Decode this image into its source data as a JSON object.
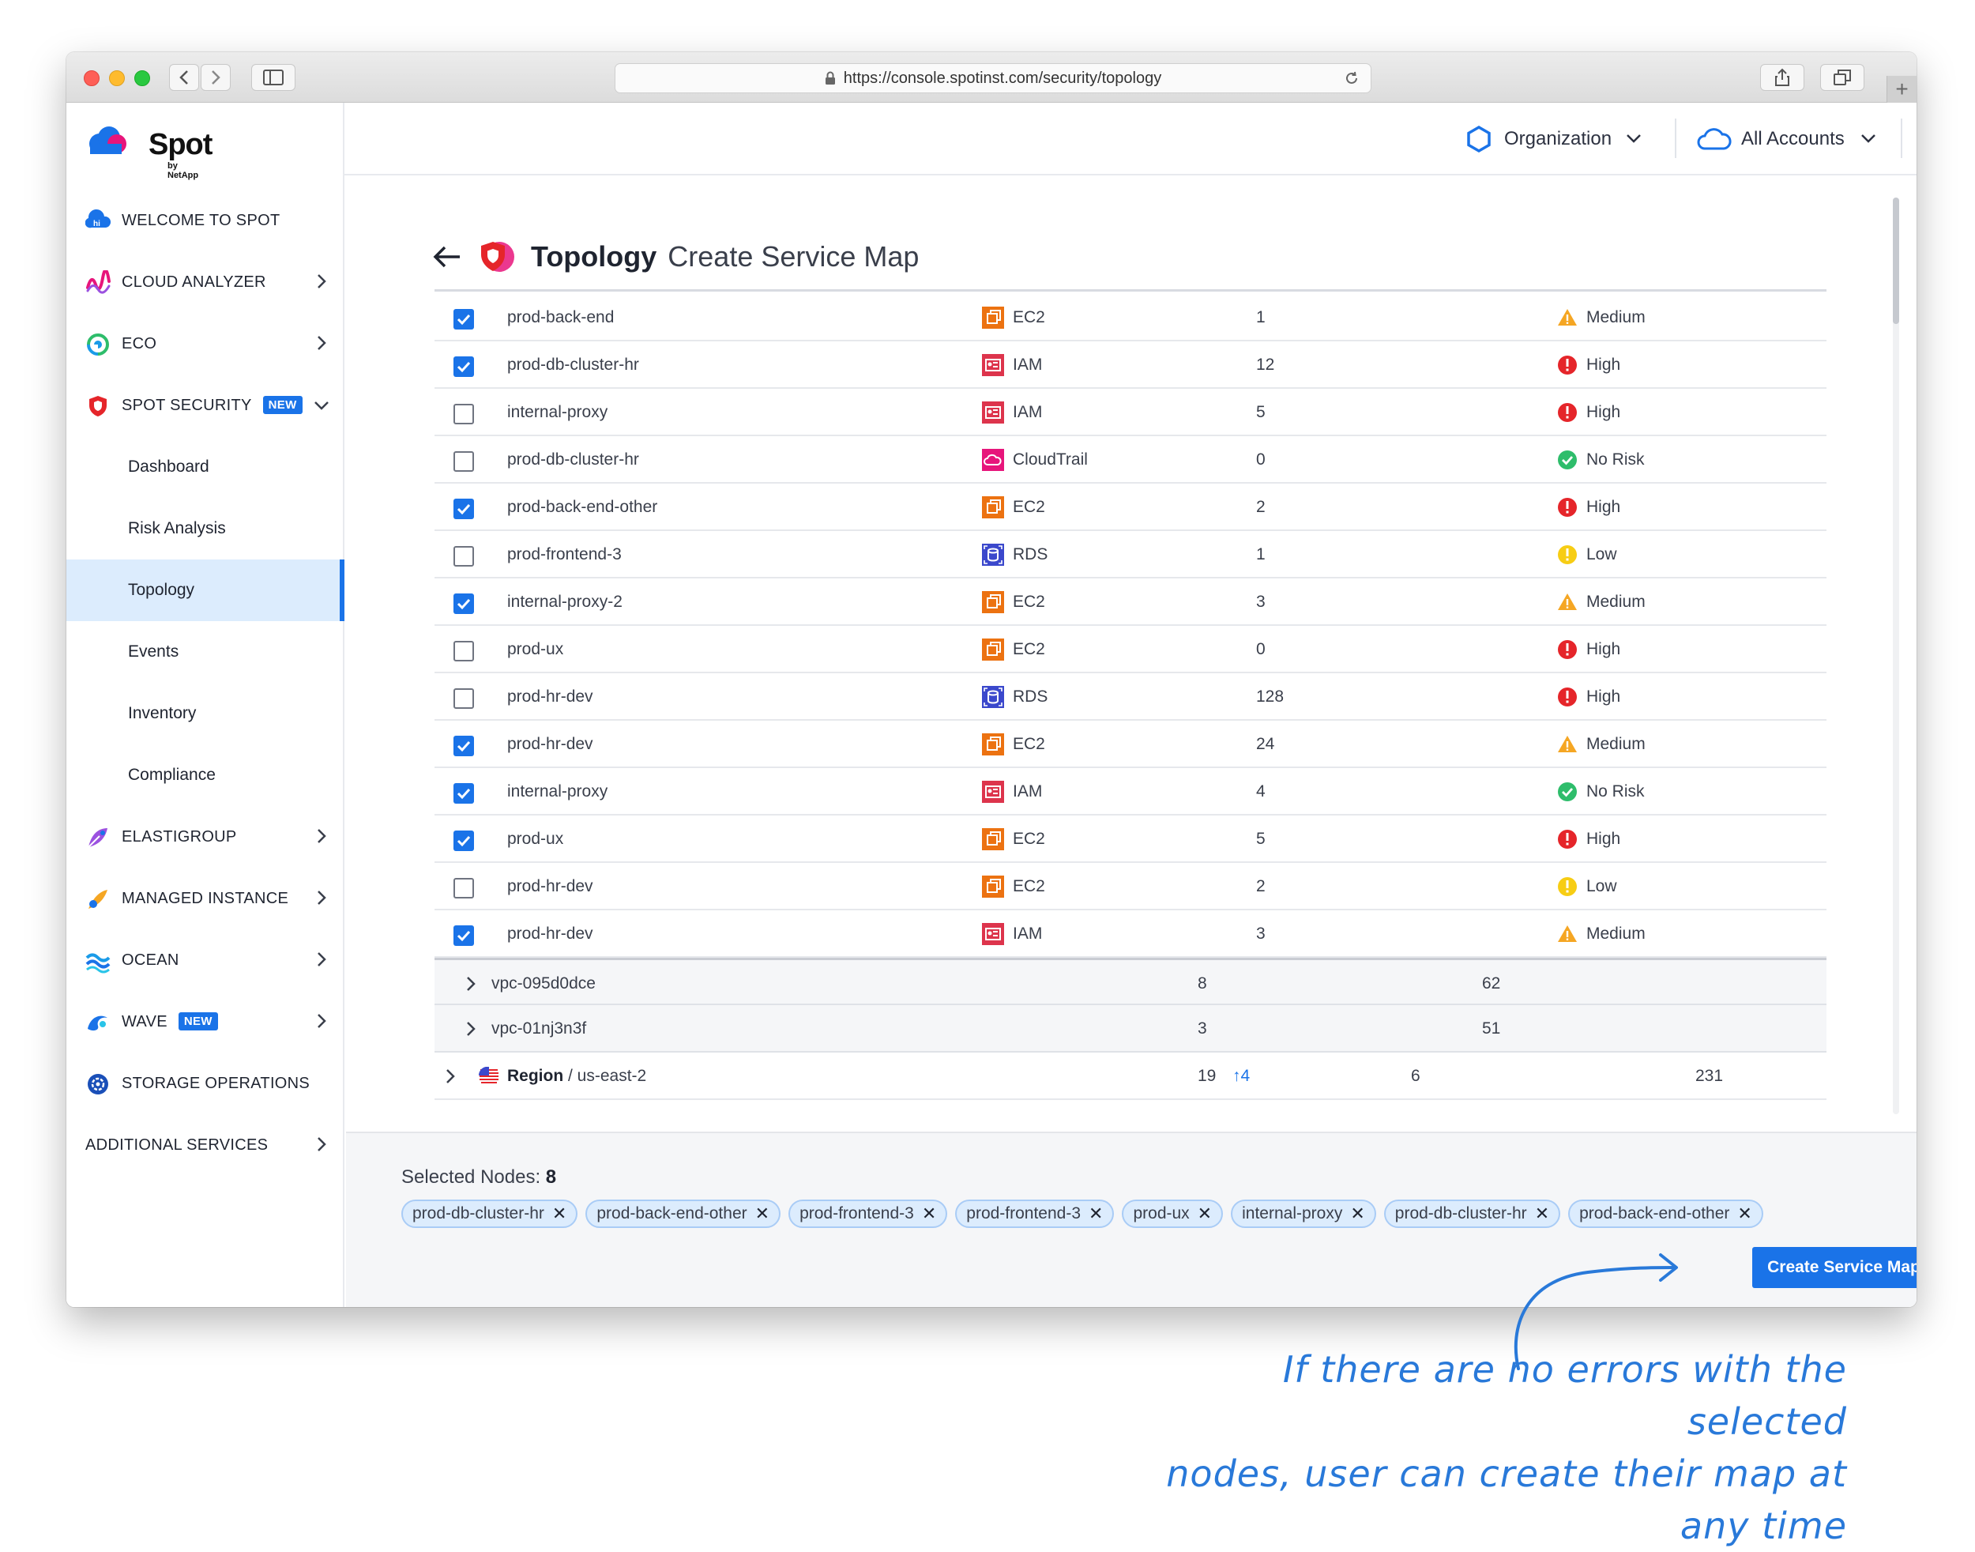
{
  "browser": {
    "url": "https://console.spotinst.com/security/topology"
  },
  "brand": {
    "name": "Spot",
    "sub": "by NetApp",
    "accent": "#1a73e8"
  },
  "sidebar": {
    "items": [
      {
        "label": "WELCOME TO SPOT",
        "icon": "hi-icon"
      },
      {
        "label": "CLOUD ANALYZER",
        "icon": "cloud-analyzer-icon"
      },
      {
        "label": "ECO",
        "icon": "eco-icon"
      },
      {
        "label": "SPOT SECURITY",
        "icon": "shield-icon",
        "badge": "NEW"
      },
      {
        "label": "ELASTIGROUP",
        "icon": "elastigroup-icon"
      },
      {
        "label": "MANAGED INSTANCE",
        "icon": "managed-instance-icon"
      },
      {
        "label": "OCEAN",
        "icon": "ocean-icon"
      },
      {
        "label": "WAVE",
        "icon": "wave-icon",
        "badge": "NEW"
      },
      {
        "label": "STORAGE OPERATIONS",
        "icon": "gear-icon"
      },
      {
        "label": "ADDITIONAL SERVICES"
      }
    ],
    "security_sub": [
      "Dashboard",
      "Risk Analysis",
      "Topology",
      "Events",
      "Inventory",
      "Compliance"
    ]
  },
  "header": {
    "organization": "Organization",
    "accounts": "All Accounts"
  },
  "page": {
    "title": "Topology",
    "subtitle": "Create Service Map"
  },
  "rows": [
    {
      "checked": true,
      "name": "prod-back-end",
      "type": "EC2",
      "count": "1",
      "risk": "Medium"
    },
    {
      "checked": true,
      "name": "prod-db-cluster-hr",
      "type": "IAM",
      "count": "12",
      "risk": "High"
    },
    {
      "checked": false,
      "name": "internal-proxy",
      "type": "IAM",
      "count": "5",
      "risk": "High"
    },
    {
      "checked": false,
      "name": "prod-db-cluster-hr",
      "type": "CloudTrail",
      "count": "0",
      "risk": "No Risk"
    },
    {
      "checked": true,
      "name": "prod-back-end-other",
      "type": "EC2",
      "count": "2",
      "risk": "High"
    },
    {
      "checked": false,
      "name": "prod-frontend-3",
      "type": "RDS",
      "count": "1",
      "risk": "Low"
    },
    {
      "checked": true,
      "name": "internal-proxy-2",
      "type": "EC2",
      "count": "3",
      "risk": "Medium"
    },
    {
      "checked": false,
      "name": "prod-ux",
      "type": "EC2",
      "count": "0",
      "risk": "High"
    },
    {
      "checked": false,
      "name": "prod-hr-dev",
      "type": "RDS",
      "count": "128",
      "risk": "High"
    },
    {
      "checked": true,
      "name": "prod-hr-dev",
      "type": "EC2",
      "count": "24",
      "risk": "Medium"
    },
    {
      "checked": true,
      "name": "internal-proxy",
      "type": "IAM",
      "count": "4",
      "risk": "No Risk"
    },
    {
      "checked": true,
      "name": "prod-ux",
      "type": "EC2",
      "count": "5",
      "risk": "High"
    },
    {
      "checked": false,
      "name": "prod-hr-dev",
      "type": "EC2",
      "count": "2",
      "risk": "Low"
    },
    {
      "checked": true,
      "name": "prod-hr-dev",
      "type": "IAM",
      "count": "3",
      "risk": "Medium"
    }
  ],
  "groups": [
    {
      "name": "vpc-095d0dce",
      "a": "8",
      "b": "62"
    },
    {
      "name": "vpc-01nj3n3f",
      "a": "3",
      "b": "51"
    }
  ],
  "region": {
    "label": "Region",
    "name": "/ us-east-2",
    "a": "19",
    "up": "4",
    "b": "6",
    "c": "231"
  },
  "footer": {
    "selected_label": "Selected Nodes:",
    "selected_count": "8",
    "chips": [
      "prod-db-cluster-hr",
      "prod-back-end-other",
      "prod-frontend-3",
      "prod-frontend-3",
      "prod-ux",
      "internal-proxy",
      "prod-db-cluster-hr",
      "prod-back-end-other"
    ],
    "cta": "Create Service Map"
  },
  "annotation": {
    "line1": "If there are no errors with the selected",
    "line2": "nodes, user can create their map at any time"
  },
  "colors": {
    "ec2": "#ec7211",
    "iam": "#dd344c",
    "cloudtrail": "#e7157b",
    "rds": "#3b48cc",
    "high": "#e5252a",
    "medium": "#f5a623",
    "low": "#f7cd14",
    "norisk": "#2ebd6b"
  }
}
